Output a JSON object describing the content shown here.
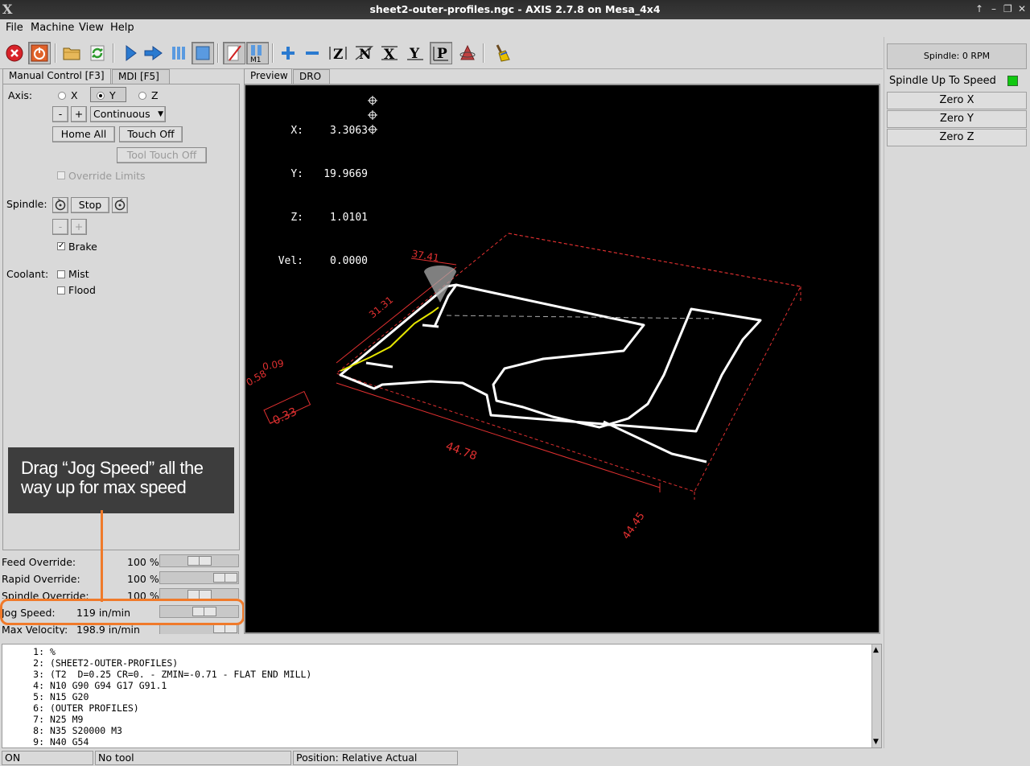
{
  "window": {
    "title": "sheet2-outer-profiles.ngc - AXIS 2.7.8 on Mesa_4x4",
    "logo": "X",
    "controls": [
      "↑",
      "–",
      "❐",
      "✕"
    ]
  },
  "menu": {
    "file": "File",
    "machine": "Machine",
    "view": "View",
    "help": "Help"
  },
  "toolbar": {
    "icons": [
      "estop-icon",
      "power-icon",
      "open-folder-icon",
      "reload-icon",
      "run-icon",
      "step-icon",
      "pause-icon",
      "stop-icon",
      "block-delete-icon",
      "optional-stop-icon",
      "zoom-in-icon",
      "zoom-out-icon",
      "view-z-icon",
      "view-z2-icon",
      "view-x-icon",
      "view-y-icon",
      "view-p-icon",
      "rotate-icon",
      "clear-plot-icon"
    ],
    "m1_label": "M1"
  },
  "tabs": {
    "left": [
      "Manual Control [F3]",
      "MDI [F5]"
    ],
    "right": [
      "Preview",
      "DRO"
    ]
  },
  "manual": {
    "axis_label": "Axis:",
    "axes": [
      "X",
      "Y",
      "Z"
    ],
    "selected_axis": "Y",
    "minus": "-",
    "plus": "+",
    "jog_mode": "Continuous",
    "home_all": "Home All",
    "touch_off": "Touch Off",
    "tool_touch_off": "Tool Touch Off",
    "override_limits": "Override Limits",
    "spindle_label": "Spindle:",
    "stop": "Stop",
    "brake": "Brake",
    "brake_checked": true,
    "coolant_label": "Coolant:",
    "mist": "Mist",
    "flood": "Flood"
  },
  "callout": {
    "line1": "Drag “Jog Speed” all the",
    "line2": "way up for max speed"
  },
  "overrides": [
    {
      "name": "Feed Override:",
      "value": "100 %",
      "level": 0.5
    },
    {
      "name": "Rapid Override:",
      "value": "100 %",
      "level": 1.0
    },
    {
      "name": "Spindle Override:",
      "value": "100 %",
      "level": 0.5
    },
    {
      "name": "Jog Speed:",
      "value": "119 in/min",
      "level": 0.6
    },
    {
      "name": "Max Velocity:",
      "value": "198.9 in/min",
      "level": 1.0
    }
  ],
  "dro": {
    "x_label": "X:",
    "x": "3.3063",
    "y_label": "Y:",
    "y": "19.9669",
    "z_label": "Z:",
    "z": "1.0101",
    "vel_label": "Vel:",
    "vel": "0.0000"
  },
  "preview_dims": [
    "37.41",
    "31.31",
    "0.09",
    "0.58",
    "-0.33",
    "44.78",
    "44.45"
  ],
  "right_panel": {
    "spindle_speed": "Spindle:     0 RPM",
    "up_to_speed": "Spindle Up To Speed",
    "zero_x": "Zero X",
    "zero_y": "Zero Y",
    "zero_z": "Zero Z",
    "led_color": "#10c810"
  },
  "gcode": [
    {
      "n": "1:",
      "text": "%"
    },
    {
      "n": "2:",
      "text": "(SHEET2-OUTER-PROFILES)"
    },
    {
      "n": "3:",
      "text": "(T2  D=0.25 CR=0. - ZMIN=-0.71 - FLAT END MILL)"
    },
    {
      "n": "4:",
      "text": "N10 G90 G94 G17 G91.1"
    },
    {
      "n": "5:",
      "text": "N15 G20"
    },
    {
      "n": "6:",
      "text": "(OUTER PROFILES)"
    },
    {
      "n": "7:",
      "text": "N25 M9"
    },
    {
      "n": "8:",
      "text": "N35 S20000 M3"
    },
    {
      "n": "9:",
      "text": "N40 G54"
    }
  ],
  "status": {
    "state": "ON",
    "tool": "No tool",
    "position": "Position: Relative Actual"
  },
  "colors": {
    "accent": "#f07a2a",
    "dim_red": "#e03030",
    "path_white": "#ffffff",
    "toolpath_yellow": "#e6e600"
  }
}
